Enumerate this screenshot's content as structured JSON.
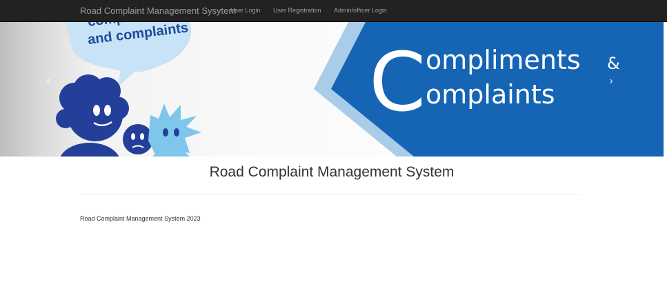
{
  "navbar": {
    "brand": "Road Complaint Management Sysytem",
    "links": [
      {
        "label": "User Login"
      },
      {
        "label": "User Registration"
      },
      {
        "label": "Admin/officer Login"
      }
    ],
    "background": "#222222",
    "link_color": "#9d9d9d"
  },
  "carousel": {
    "bubble_text": "and complaints",
    "bubble_text_partial": "comp",
    "headline_line1": "ompliments",
    "headline_ampersand": "&",
    "headline_line2": "omplaints",
    "big_letter": "C",
    "prev_icon": "chevron-left-icon",
    "next_icon": "chevron-right-icon",
    "prev_glyph": "‹",
    "next_glyph": "›",
    "colors": {
      "banner_blue": "#1565b4",
      "light_blue": "#a9cde8",
      "character_blue": "#233f99",
      "light_character": "#7fc6ec"
    }
  },
  "main": {
    "title": "Road Complaint Management System"
  },
  "footer": {
    "text": "Road Complaint Management System 2023"
  }
}
